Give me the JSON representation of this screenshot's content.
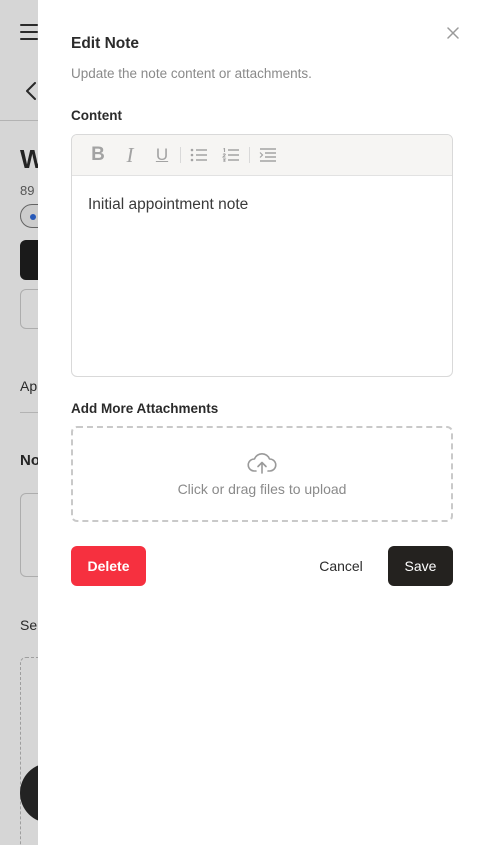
{
  "drawer": {
    "title": "Edit Note",
    "description": "Update the note content or attachments.",
    "content_label": "Content",
    "content_value": "Initial appointment note",
    "attachments_label": "Add More Attachments",
    "upload_text": "Click or drag files to upload",
    "delete_label": "Delete",
    "cancel_label": "Cancel",
    "save_label": "Save"
  },
  "toolbar": {
    "bold_glyph": "B",
    "italic_glyph": "I",
    "underline_glyph": "U",
    "tools": [
      "bold-icon",
      "italic-icon",
      "underline-icon",
      "bullet-list-icon",
      "numbered-list-icon",
      "indent-icon"
    ]
  },
  "background": {
    "title_fragment": "W",
    "subtitle_fragment": "89",
    "label1_fragment": "Ap",
    "label2_fragment": "No",
    "label3_fragment": "Se"
  },
  "colors": {
    "delete": "#f6303f",
    "save": "#24221f",
    "accent_dot": "#2f6bdc"
  }
}
